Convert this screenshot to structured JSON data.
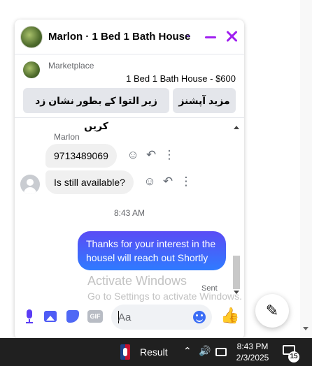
{
  "chat": {
    "title": "Marlon · 1 Bed 1 Bath House",
    "marketplace_label": "Marketplace",
    "listing": "1 Bed 1 Bath House - $600",
    "actions": [
      "زیر التوا کے بطور نشان زد کریں",
      "مزید آپشنز"
    ]
  },
  "messages": {
    "sender": "Marlon",
    "incoming": [
      "9713489069",
      "Is still available?"
    ],
    "timestamp": "8:43 AM",
    "outgoing": "Thanks for your interest in the housel will reach out Shortly",
    "status": "Sent"
  },
  "composer": {
    "placeholder": "Aa",
    "gif_label": "GIF"
  },
  "watermark": {
    "line1": "Activate Windows",
    "line2": "Go to Settings to activate Windows."
  },
  "taskbar": {
    "result_label": "Result",
    "time": "8:43 PM",
    "date": "2/3/2025",
    "notification_count": "15"
  },
  "icons": {
    "message_actions": [
      "smiley-icon",
      "reply-icon",
      "more-icon"
    ],
    "composer": [
      "mic-icon",
      "photo-icon",
      "sticker-icon",
      "gif-icon",
      "emoji-icon",
      "like-icon"
    ]
  },
  "colors": {
    "accent": "#a020f0",
    "outgoing_bubble": "#4c6ef5",
    "taskbar": "#202020"
  }
}
